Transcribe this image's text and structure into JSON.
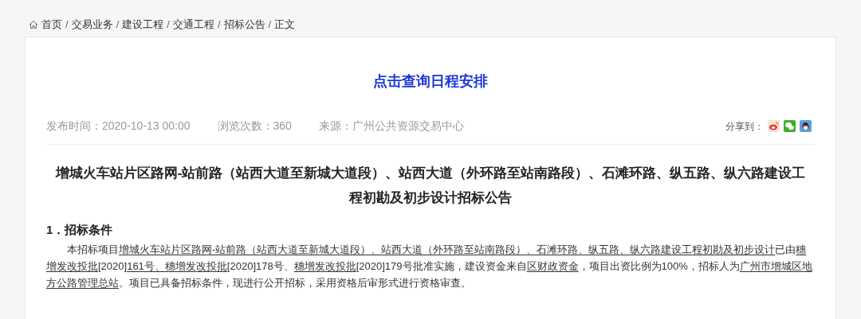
{
  "breadcrumb": [
    {
      "label": "首页"
    },
    {
      "label": "交易业务"
    },
    {
      "label": "建设工程"
    },
    {
      "label": "交通工程"
    },
    {
      "label": "招标公告"
    },
    {
      "label": "正文"
    }
  ],
  "breadcrumb_separator": "/",
  "schedule_link": "点击查询日程安排",
  "meta": [
    {
      "label": "发布时间：",
      "value": "2020-10-13 00:00"
    },
    {
      "label": "浏览次数：",
      "value": "360"
    },
    {
      "label": "来源：",
      "value": "广州公共资源交易中心"
    }
  ],
  "share": {
    "label": "分享到：",
    "targets": [
      {
        "kind": "weibo"
      },
      {
        "kind": "wechat"
      },
      {
        "kind": "qq"
      }
    ]
  },
  "article": {
    "title": "增城火车站片区路网-站前路（站西大道至新城大道段）、站西大道（外环路至站南路段）、石滩环路、纵五路、纵六路建设工程初勘及初步设计招标公告",
    "sections": [
      {
        "heading": "1．招标条件",
        "paragraph": [
          {
            "text": "本招标项目",
            "underline": false
          },
          {
            "text": "增城火车站片区路网-站前路（站西大道至新城大道段）、站西大道（外环路至站南路段）、石滩环路、纵五路、纵六路建设工程初勘及初步设计",
            "underline": true
          },
          {
            "text": "已由",
            "underline": false
          },
          {
            "text": "穗增发改投批",
            "underline": true
          },
          {
            "text": "[2020]",
            "underline": false
          },
          {
            "text": "161号、穗增发改投批",
            "underline": true
          },
          {
            "text": "[2020]178号、",
            "underline": false
          },
          {
            "text": "穗增发改投批",
            "underline": true
          },
          {
            "text": "[2020]179号批准实施，建设资金来自",
            "underline": false
          },
          {
            "text": "区财政资金",
            "underline": true
          },
          {
            "text": "，项目出资比例为100%，招标人为",
            "underline": false
          },
          {
            "text": "广州市增城区地方公路管理总站",
            "underline": true
          },
          {
            "text": "。项目已具备招标条件，现进行公开招标，采用资格后审形式进行资格审查。",
            "underline": false
          }
        ]
      }
    ]
  }
}
